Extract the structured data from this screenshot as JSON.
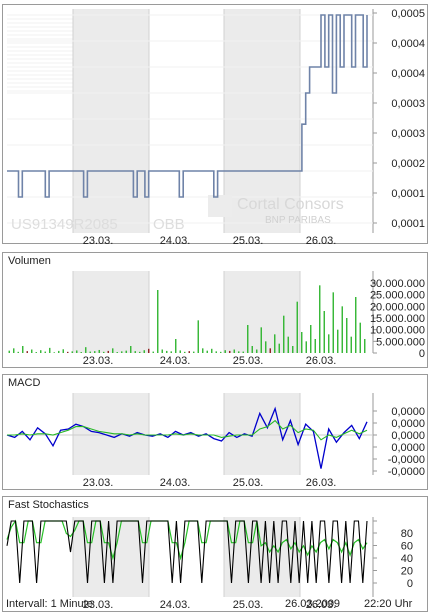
{
  "instrument": {
    "isin": "US91349R2085",
    "exchange": "OBB"
  },
  "watermark": {
    "line1": "Cortal Consors",
    "line2": "BNP PARIBAS"
  },
  "footer": {
    "interval": "Intervall: 1 Minute",
    "date": "26.03.2009",
    "time": "22:20 Uhr"
  },
  "colors": {
    "weekend_shade": "#ebebeb",
    "price_line": "#6f83a8",
    "volume_up": "#2fb52f",
    "volume_down": "#8b1a1a",
    "macd": "#0000cc",
    "signal": "#27b827",
    "stoch_k": "#000000",
    "stoch_d": "#27c027"
  },
  "chart_data": [
    {
      "name": "price",
      "type": "line",
      "x_ticks": [
        "23.03.",
        "24.03.",
        "25.03.",
        "26.03."
      ],
      "y_ticks": [
        "0,0005",
        "0,0004",
        "0,0004",
        "0,0003",
        "0,0003",
        "0,0002",
        "0,0001",
        "0,0001"
      ],
      "ylim": [
        0.0001,
        0.0005
      ],
      "series": [
        {
          "values": [
            0.0002,
            0.0002,
            0.0002,
            0.00015,
            0.0002,
            0.0002,
            0.0002,
            0.0002,
            0.0002,
            0.0002,
            0.00015,
            0.0002,
            0.0002,
            0.0002,
            0.0002,
            0.0002,
            0.0002,
            0.0002,
            0.0002,
            0.0002,
            0.00015,
            0.0002,
            0.0002,
            0.0002,
            0.0002,
            0.0002,
            0.0002,
            0.0002,
            0.0002,
            0.0002,
            0.0002,
            0.0002,
            0.0002,
            0.00015,
            0.0002,
            0.0002,
            0.00015,
            0.0002,
            0.0002,
            0.0002,
            0.0002,
            0.0002,
            0.0002,
            0.0002,
            0.0002,
            0.00015,
            0.0002,
            0.0002,
            0.0002,
            0.0002,
            0.0002,
            0.0002,
            0.0002,
            0.0002,
            0.00015,
            0.0002,
            0.0002,
            0.0002,
            0.0002,
            0.0002,
            0.0002,
            0.0002,
            0.0002,
            0.0002,
            0.0002,
            0.0002,
            0.0002,
            0.0002,
            0.0002,
            0.0002,
            0.0002,
            0.0002,
            0.0002,
            0.0002,
            0.0002,
            0.0002,
            0.0002,
            0.00029,
            0.00035,
            0.0004,
            0.0004,
            0.0004,
            0.0005,
            0.0004,
            0.0005,
            0.00035,
            0.0005,
            0.0004,
            0.0005,
            0.0005,
            0.0004,
            0.0005,
            0.0005,
            0.0004,
            0.0005
          ]
        }
      ]
    },
    {
      "name": "volume",
      "type": "bar",
      "title": "Volumen",
      "x_ticks": [
        "23.03.",
        "24.03.",
        "25.03.",
        "26.03."
      ],
      "y_ticks": [
        "30.000.000",
        "25.000.000",
        "20.000.000",
        "15.000.000",
        "10.000.000",
        "5.000.000",
        "0"
      ],
      "ylim": [
        0,
        30000000
      ],
      "series": [
        {
          "values": [
            1000000,
            2000000,
            500000,
            3000000,
            800000,
            1500000,
            400000,
            1200000,
            600000,
            2200000,
            300000,
            900000,
            1600000,
            500000,
            700000,
            1100000,
            400000,
            2500000,
            600000,
            800000,
            1300000,
            500000,
            900000,
            2000000,
            400000,
            700000,
            1000000,
            3000000,
            800000,
            500000,
            1200000,
            1800000,
            600000,
            27000000,
            1500000,
            900000,
            700000,
            6000000,
            1100000,
            500000,
            800000,
            600000,
            14000000,
            2000000,
            1000000,
            1800000,
            700000,
            500000,
            1200000,
            900000,
            1500000,
            700000,
            600000,
            12000000,
            3000000,
            1500000,
            11000000,
            5000000,
            2000000,
            8000000,
            4000000,
            16000000,
            7000000,
            3000000,
            22000000,
            9000000,
            5000000,
            12000000,
            6000000,
            29000000,
            18000000,
            8000000,
            26000000,
            10000000,
            20000000,
            15000000,
            7000000,
            24000000,
            13000000,
            6000000
          ]
        }
      ]
    },
    {
      "name": "macd",
      "type": "line",
      "title": "MACD",
      "x_ticks": [
        "23.03.",
        "24.03.",
        "25.03.",
        "26.03."
      ],
      "y_ticks": [
        "0,0000",
        "0,0000",
        "0,0000",
        "0,0000",
        "-0,0000",
        "-0,0000"
      ],
      "ylim": [
        -3,
        3
      ],
      "series": [
        {
          "name": "MACD",
          "values": [
            0,
            -0.2,
            0.3,
            -0.4,
            0.6,
            0.1,
            -0.9,
            0.4,
            0.5,
            0.9,
            0.7,
            0.3,
            0.2,
            0,
            -0.2,
            0.1,
            -0.1,
            0.2,
            0,
            -0.1,
            0.1,
            -0.2,
            0.3,
            0,
            0.2,
            -0.1,
            0.1,
            -0.3,
            -0.5,
            0.2,
            -0.2,
            0.1,
            -0.1,
            1.8,
            0.6,
            2.2,
            -0.4,
            1.2,
            -0.8,
            0.9,
            0.3,
            -2.8,
            0.5,
            -0.6,
            0.2,
            0.8,
            -0.3,
            1.1
          ]
        },
        {
          "name": "Signal",
          "values": [
            0,
            0,
            0.1,
            0,
            0.1,
            0.1,
            0,
            0.2,
            0.4,
            0.7,
            0.7,
            0.5,
            0.3,
            0.2,
            0.1,
            0.1,
            0,
            0.1,
            0,
            0,
            0,
            0,
            0.1,
            0,
            0.1,
            0,
            0,
            0,
            -0.2,
            -0.1,
            0,
            0,
            0,
            0.5,
            0.7,
            1.2,
            0.5,
            0.8,
            0.2,
            0.5,
            0.4,
            -0.4,
            0,
            -0.2,
            0.1,
            0.4,
            0.1,
            0.4
          ]
        }
      ]
    },
    {
      "name": "fast_stochastics",
      "type": "line",
      "title": "Fast Stochastics",
      "x_ticks": [
        "23.03.",
        "24.03.",
        "25.03.",
        "26.03."
      ],
      "y_ticks": [
        "80",
        "60",
        "40",
        "20",
        "0"
      ],
      "ylim": [
        0,
        100
      ],
      "series": [
        {
          "name": "%K",
          "values": [
            60,
            100,
            100,
            0,
            100,
            100,
            100,
            0,
            100,
            100,
            100,
            100,
            100,
            100,
            100,
            50,
            100,
            100,
            100,
            0,
            100,
            100,
            100,
            0,
            100,
            0,
            100,
            100,
            100,
            100,
            100,
            100,
            0,
            100,
            100,
            100,
            100,
            100,
            100,
            0,
            100,
            0,
            100,
            100,
            100,
            100,
            0,
            100,
            100,
            100,
            100,
            100,
            100,
            0,
            100,
            100,
            100,
            0,
            100,
            100,
            0,
            100,
            0,
            100,
            0,
            100,
            100,
            0,
            100,
            0,
            100,
            0,
            100,
            0,
            100,
            100,
            0,
            100,
            100,
            0,
            100,
            0,
            100,
            100,
            0,
            100
          ]
        },
        {
          "name": "%D",
          "values": [
            70,
            90,
            100,
            65,
            65,
            100,
            100,
            65,
            65,
            100,
            100,
            100,
            100,
            100,
            80,
            75,
            85,
            100,
            100,
            65,
            65,
            100,
            100,
            65,
            65,
            40,
            65,
            100,
            100,
            100,
            100,
            100,
            65,
            65,
            100,
            100,
            100,
            100,
            100,
            65,
            65,
            40,
            65,
            100,
            100,
            100,
            65,
            65,
            100,
            100,
            100,
            100,
            100,
            65,
            65,
            100,
            100,
            65,
            65,
            100,
            60,
            65,
            50,
            60,
            50,
            65,
            70,
            55,
            65,
            50,
            60,
            45,
            60,
            50,
            65,
            70,
            55,
            70,
            65,
            50,
            65,
            45,
            65,
            70,
            55,
            65
          ]
        }
      ]
    }
  ]
}
